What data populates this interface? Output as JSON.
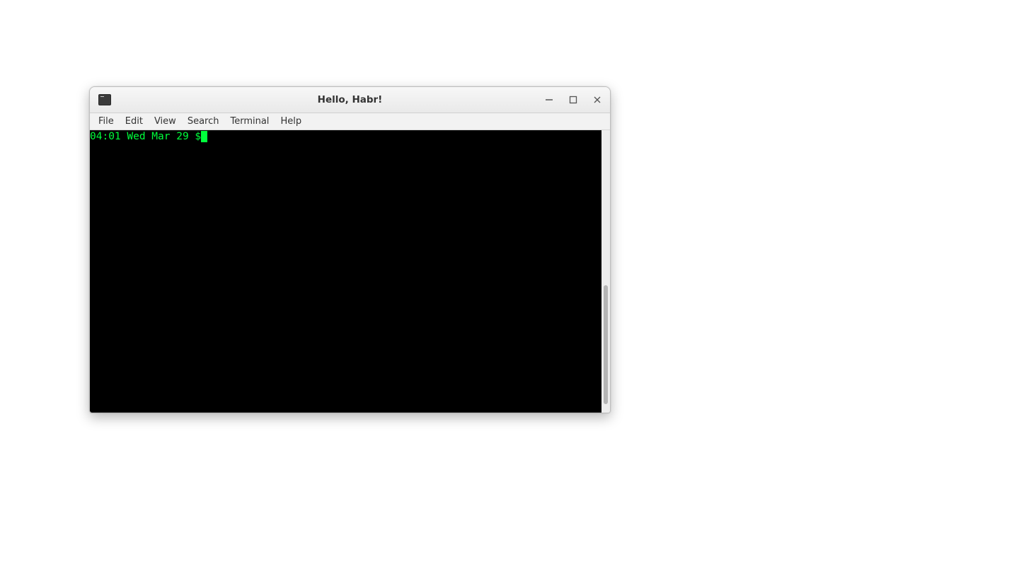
{
  "window": {
    "title": "Hello, Habr!",
    "icon": "terminal-icon"
  },
  "window_controls": {
    "minimize": "minimize",
    "maximize": "maximize",
    "close": "close"
  },
  "menubar": {
    "items": [
      {
        "label": "File"
      },
      {
        "label": "Edit"
      },
      {
        "label": "View"
      },
      {
        "label": "Search"
      },
      {
        "label": "Terminal"
      },
      {
        "label": "Help"
      }
    ]
  },
  "terminal": {
    "prompt": "04:01 Wed Mar 29 $",
    "prompt_color": "#00ff3c",
    "background": "#000000"
  }
}
